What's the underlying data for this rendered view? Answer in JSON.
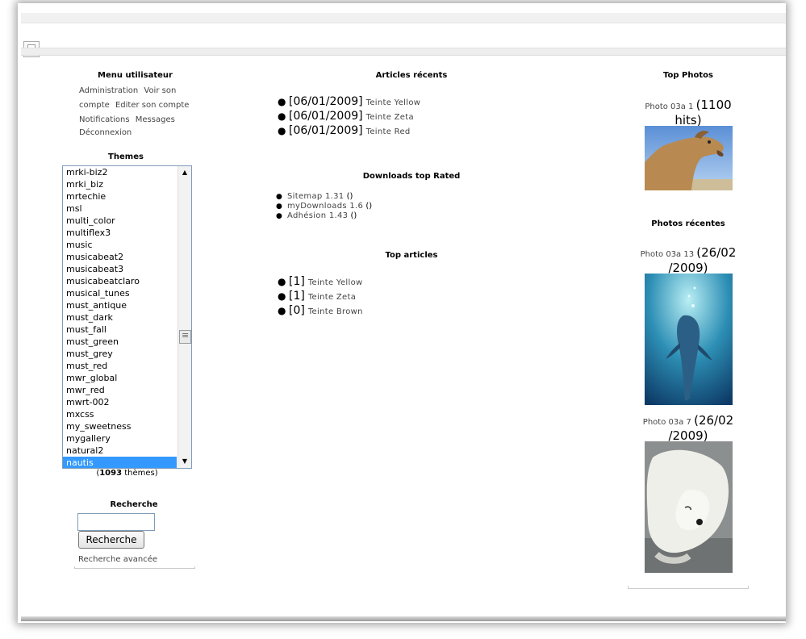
{
  "user_menu": {
    "title": "Menu utilisateur",
    "links": [
      "Administration",
      "Voir son compte",
      "Editer son compte",
      "Notifications",
      "Messages",
      "Déconnexion"
    ]
  },
  "themes": {
    "title": "Themes",
    "items": [
      "mrki-biz2",
      "mrki_biz",
      "mrtechie",
      "msl",
      "multi_color",
      "multiflex3",
      "music",
      "musicabeat2",
      "musicabeat3",
      "musicabeatclaro",
      "musical_tunes",
      "must_antique",
      "must_dark",
      "must_fall",
      "must_green",
      "must_grey",
      "must_red",
      "mwr_global",
      "mwr_red",
      "mwrt-002",
      "mxcss",
      "my_sweetness",
      "mygallery",
      "natural2",
      "nautis"
    ],
    "selected": "nautis",
    "count": "1093",
    "count_suffix": "thèmes"
  },
  "search": {
    "title": "Recherche",
    "button_label": "Recherche",
    "advanced_link": "Recherche avancée",
    "value": ""
  },
  "recent_articles": {
    "title": "Articles récents",
    "items": [
      {
        "date": "[06/01/2009]",
        "title": "Teinte Yellow"
      },
      {
        "date": "[06/01/2009]",
        "title": "Teinte Zeta"
      },
      {
        "date": "[06/01/2009]",
        "title": "Teinte Red"
      }
    ]
  },
  "downloads": {
    "title": "Downloads top Rated",
    "items": [
      {
        "name": "Sitemap 1.31",
        "votes": "()"
      },
      {
        "name": "myDownloads 1.6",
        "votes": "()"
      },
      {
        "name": "Adhésion 1.43",
        "votes": "()"
      }
    ]
  },
  "top_articles": {
    "title": "Top articles",
    "items": [
      {
        "count": "[1]",
        "title": "Teinte Yellow"
      },
      {
        "count": "[1]",
        "title": "Teinte Zeta"
      },
      {
        "count": "[0]",
        "title": "Teinte Brown"
      }
    ]
  },
  "top_photos": {
    "title": "Top Photos",
    "photo": {
      "name": "Photo 03a 1",
      "stat_a": "(1100",
      "stat_b": "hits)",
      "subject": "camel"
    }
  },
  "recent_photos": {
    "title": "Photos récentes",
    "items": [
      {
        "name": "Photo 03a 13",
        "date_a": "(26/02",
        "date_b": "/2009)",
        "subject": "dolphin"
      },
      {
        "name": "Photo 03a 7",
        "date_a": "(26/02",
        "date_b": "/2009)",
        "subject": "polar-bear"
      }
    ]
  }
}
